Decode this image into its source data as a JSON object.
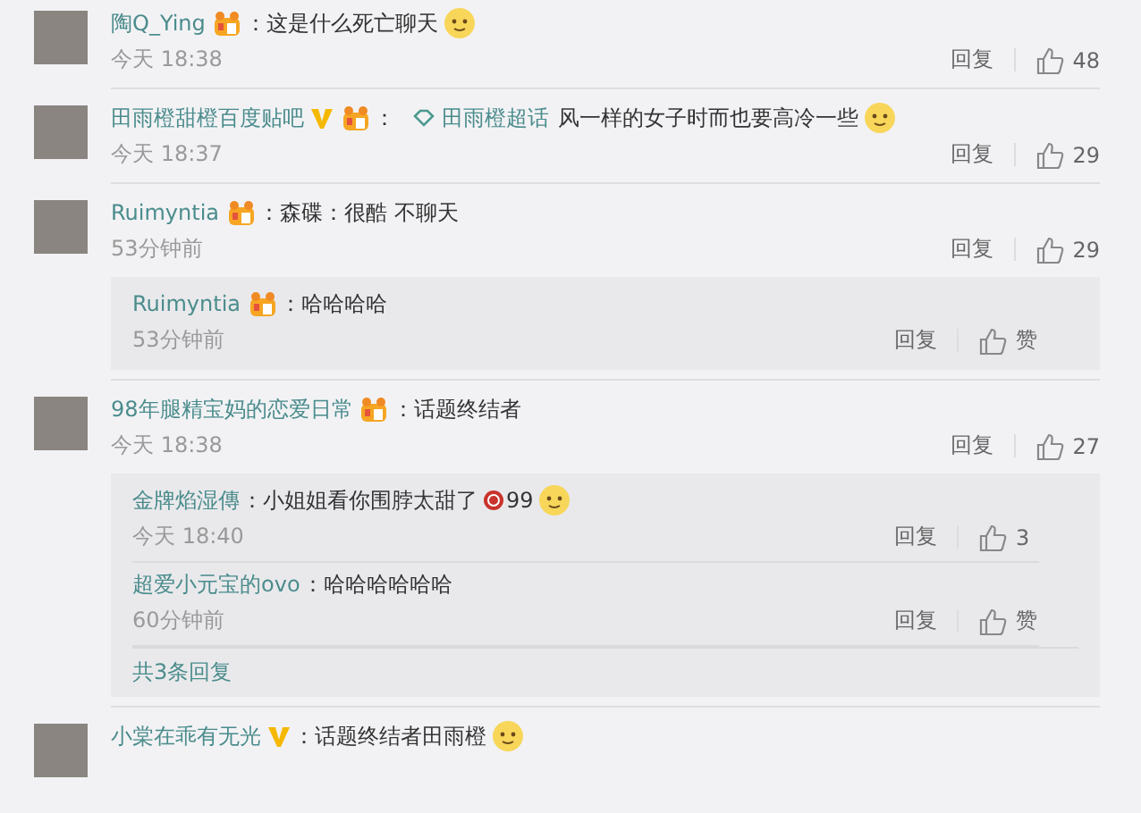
{
  "comments": [
    {
      "name": "陶Q_Ying",
      "verified": false,
      "vip": true,
      "content": [
        {
          "kind": "text",
          "text": "：这是什么死亡聊天"
        },
        {
          "kind": "emoji"
        }
      ],
      "time": "今天 18:38",
      "reply_label": "回复",
      "likes": "48"
    },
    {
      "name": "田雨橙甜橙百度贴吧",
      "verified": true,
      "vip": true,
      "content": [
        {
          "kind": "text",
          "text": "："
        },
        {
          "kind": "topic",
          "text": "田雨橙超话"
        },
        {
          "kind": "text",
          "text": "风一样的女子时而也要高冷一些"
        },
        {
          "kind": "emoji"
        }
      ],
      "time": "今天 18:37",
      "reply_label": "回复",
      "likes": "29"
    },
    {
      "name": "Ruimyntia",
      "verified": false,
      "vip": true,
      "content": [
        {
          "kind": "text",
          "text": "：森碟：很酷 不聊天"
        }
      ],
      "time": "53分钟前",
      "reply_label": "回复",
      "likes": "29",
      "replies": {
        "items": [
          {
            "name": "Ruimyntia",
            "vip": true,
            "content": [
              {
                "kind": "text",
                "text": "：哈哈哈哈"
              }
            ],
            "time": "53分钟前",
            "reply_label": "回复",
            "likes": "赞"
          }
        ]
      }
    },
    {
      "name": "98年腿精宝妈的恋爱日常",
      "verified": false,
      "vip": true,
      "content": [
        {
          "kind": "text",
          "text": "：话题终结者"
        }
      ],
      "time": "今天 18:38",
      "reply_label": "回复",
      "likes": "27",
      "replies": {
        "items": [
          {
            "name": "金牌焰湿傳",
            "vip": false,
            "content": [
              {
                "kind": "text",
                "text": "：小姐姐看你围脖太甜了"
              },
              {
                "kind": "medal",
                "text": "99"
              },
              {
                "kind": "emoji"
              }
            ],
            "time": "今天 18:40",
            "reply_label": "回复",
            "likes": "3"
          },
          {
            "name": "超爱小元宝的ovo",
            "vip": false,
            "content": [
              {
                "kind": "text",
                "text": "：哈哈哈哈哈哈"
              }
            ],
            "time": "60分钟前",
            "reply_label": "回复",
            "likes": "赞"
          }
        ],
        "more": "共3条回复"
      }
    },
    {
      "name": "小棠在乖有无光",
      "verified": true,
      "vip": false,
      "content": [
        {
          "kind": "text",
          "text": "：话题终结者田雨橙"
        },
        {
          "kind": "emoji"
        }
      ]
    }
  ]
}
